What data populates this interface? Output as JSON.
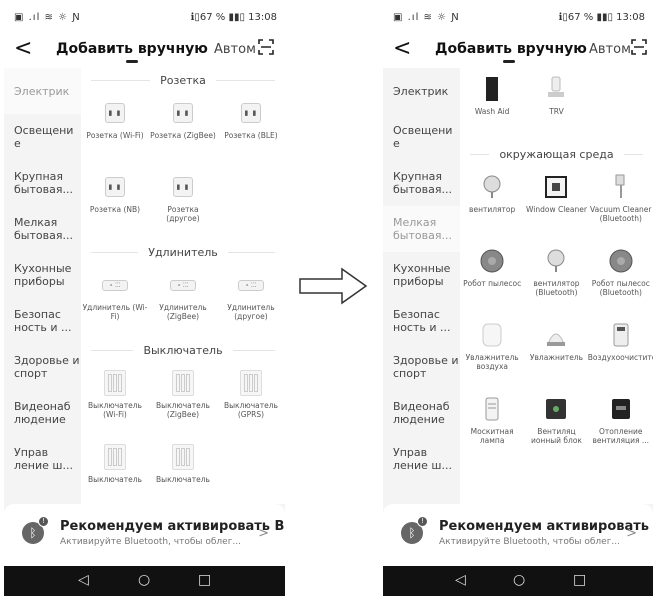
{
  "status": {
    "left_icons": "▣ .ıl ≋ ☼ Ɲ",
    "battery": "ℹ▯67 % ▮▮▯ 13:08"
  },
  "header": {
    "back": "<",
    "title": "Добавить вручную",
    "other_tab": "Автом",
    "scan_icon": "scan-icon"
  },
  "sidebar": {
    "items": [
      "Электрик",
      "Освещени е",
      "Крупная бытовая...",
      "Мелкая бытовая...",
      "Кухонные приборы",
      "Безопас ность и ...",
      "Здоровье и спорт",
      "Видеонаб людение",
      "Управ ление ш..."
    ]
  },
  "left": {
    "sections": [
      {
        "title": "Розетка",
        "devices": [
          {
            "label": "Розетка (Wi-Fi)"
          },
          {
            "label": "Розетка (ZigBee)"
          },
          {
            "label": "Розетка (BLE)"
          },
          {
            "label": "Розетка (NB)"
          },
          {
            "label": "Розетка (другое)"
          }
        ]
      },
      {
        "title": "Удлинитель",
        "devices": [
          {
            "label": "Удлинитель (Wi-Fi)"
          },
          {
            "label": "Удлинитель (ZigBee)"
          },
          {
            "label": "Удлинитель (другое)"
          }
        ]
      },
      {
        "title": "Выключатель",
        "devices": [
          {
            "label": "Выключатель (Wi-Fi)"
          },
          {
            "label": "Выключатель (ZigBee)"
          },
          {
            "label": "Выключатель (GPRS)"
          },
          {
            "label": "Выключатель"
          },
          {
            "label": "Выключатель"
          }
        ]
      }
    ]
  },
  "right": {
    "top_devices": [
      {
        "label": "Wash Aid"
      },
      {
        "label": "TRV"
      }
    ],
    "section_title": "окружающая среда",
    "devices": [
      {
        "label": "вентилятор"
      },
      {
        "label": "Window Cleaner"
      },
      {
        "label": "Vacuum Cleaner (Bluetooth)"
      },
      {
        "label": "Робот пылесос"
      },
      {
        "label": "вентилятор (Bluetooth)"
      },
      {
        "label": "Робот пылесос (Bluetooth)"
      },
      {
        "label": "Увлажнитель воздуха"
      },
      {
        "label": "Увлажнитель"
      },
      {
        "label": "Воздухоочиститель"
      },
      {
        "label": "Москитная лампа"
      },
      {
        "label": "Вентиляц ионный блок"
      },
      {
        "label": "Отопление вентиляция ..."
      }
    ]
  },
  "banner": {
    "title": "Рекомендуем активировать Bl...",
    "subtitle": "Активируйте Bluetooth, чтобы облег...",
    "badge": "!",
    "arrow": ">"
  },
  "nav": {
    "back": "◁",
    "home": "○",
    "recent": "□"
  }
}
